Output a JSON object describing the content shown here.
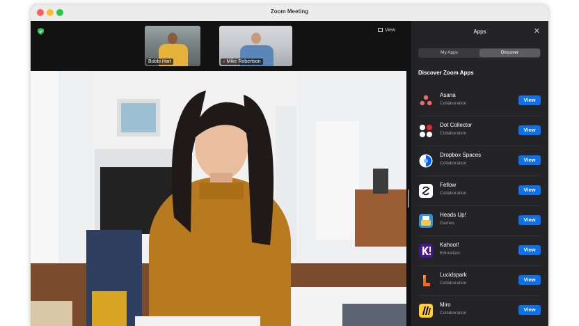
{
  "window": {
    "title": "Zoom Meeting"
  },
  "meeting": {
    "view_label": "View",
    "participants": [
      {
        "name": "Bobbi Hart",
        "muted": false
      },
      {
        "name": "Mike Robertson",
        "muted": true
      }
    ]
  },
  "apps_panel": {
    "title": "Apps",
    "tabs": {
      "my_apps": "My Apps",
      "discover": "Discover",
      "selected": "Discover"
    },
    "section_title": "Discover Zoom Apps",
    "apps": [
      {
        "name": "Asana",
        "category": "Collaboration",
        "button": "View",
        "icon": "asana-icon"
      },
      {
        "name": "Dot Collector",
        "category": "Collaboration",
        "button": "View",
        "icon": "dot-collector-icon"
      },
      {
        "name": "Dropbox Spaces",
        "category": "Collaboration",
        "button": "View",
        "icon": "dropbox-spaces-icon"
      },
      {
        "name": "Fellow",
        "category": "Collaboration",
        "button": "View",
        "icon": "fellow-icon"
      },
      {
        "name": "Heads Up!",
        "category": "Games",
        "button": "View",
        "icon": "heads-up-icon"
      },
      {
        "name": "Kahoot!",
        "category": "Education",
        "button": "View",
        "icon": "kahoot-icon"
      },
      {
        "name": "Lucidspark",
        "category": "Collaboration",
        "button": "View",
        "icon": "lucidspark-icon"
      },
      {
        "name": "Miro",
        "category": "Collaboration",
        "button": "View",
        "icon": "miro-icon"
      }
    ],
    "accent_color": "#0e71eb"
  }
}
